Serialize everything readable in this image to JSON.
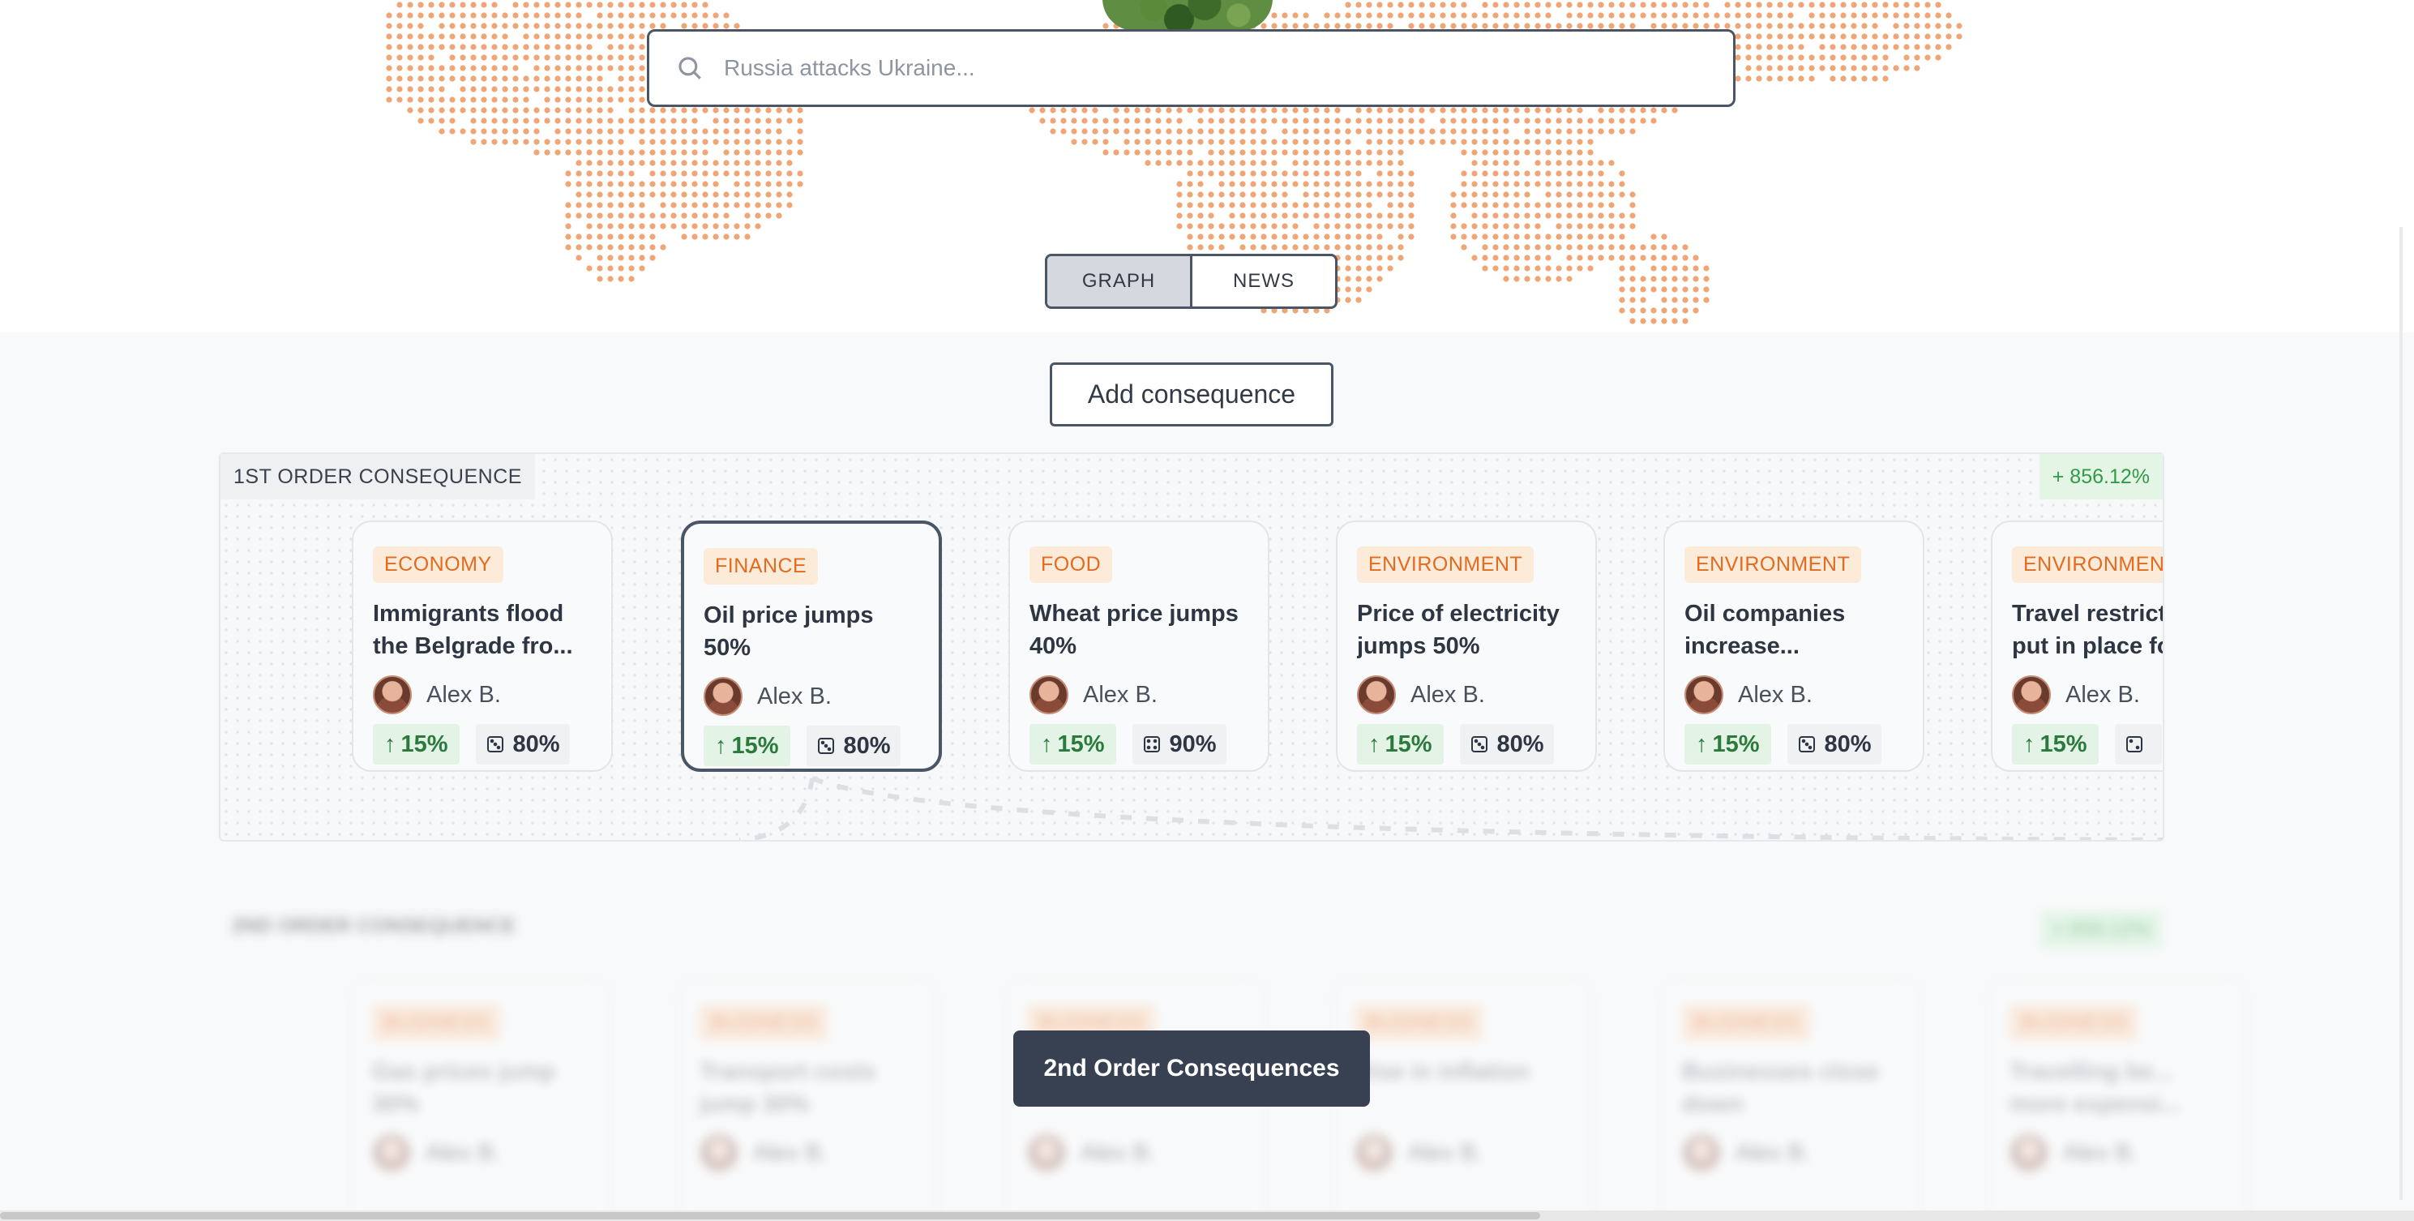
{
  "search": {
    "placeholder": "Russia attacks Ukraine..."
  },
  "view_toggle": {
    "options": [
      "GRAPH",
      "NEWS"
    ],
    "selected": "GRAPH"
  },
  "add_button_label": "Add consequence",
  "first_order": {
    "label": "1ST ORDER CONSEQUENCE",
    "badge": "+ 856.12%",
    "cards": [
      {
        "tag": "ECONOMY",
        "title": "Immigrants flood\nthe Belgrade fro...",
        "author": "Alex B.",
        "change": "15%",
        "probability": "80%"
      },
      {
        "tag": "FINANCE",
        "title": "Oil price jumps\n50%",
        "author": "Alex B.",
        "change": "15%",
        "probability": "80%"
      },
      {
        "tag": "FOOD",
        "title": "Wheat price jumps\n40%",
        "author": "Alex B.",
        "change": "15%",
        "probability": "90%"
      },
      {
        "tag": "ENVIRONMENT",
        "title": "Price of electricity\njumps 50%",
        "author": "Alex B.",
        "change": "15%",
        "probability": "80%"
      },
      {
        "tag": "ENVIRONMENT",
        "title": "Oil companies\nincrease...",
        "author": "Alex B.",
        "change": "15%",
        "probability": "80%"
      },
      {
        "tag": "ENVIRONMENT",
        "title": "Travel restrictions\nput in place for",
        "author": "Alex B.",
        "change": "15%",
        "probability": ""
      }
    ]
  },
  "second_order": {
    "label": "2ND ORDER CONSEQUENCE",
    "badge": "+ 856.12%",
    "cards": [
      {
        "tag": "BUSINESS",
        "title": "Gas prices jump\n30%",
        "author": "Alex B."
      },
      {
        "tag": "BUSINESS",
        "title": "Transport costs\njump 30%",
        "author": "Alex B."
      },
      {
        "tag": "BUSINESS",
        "title": "",
        "author": "Alex B."
      },
      {
        "tag": "BUSINESS",
        "title": "Rise in inflation",
        "author": "Alex B."
      },
      {
        "tag": "BUSINESS",
        "title": "Businesses close\ndown",
        "author": "Alex B."
      },
      {
        "tag": "BUSINESS",
        "title": "Travelling be...\nmore expensi...",
        "author": "Alex B."
      }
    ]
  },
  "cta_label": "2nd Order Consequences",
  "colors": {
    "accent_orange": "#e36b1f",
    "map_dots": "#f0a574",
    "dark_button": "#374151",
    "positive_green": "#2f9b46"
  },
  "icons": {
    "search": "search-icon",
    "up": "arrow-up-icon",
    "probability": "dice-icon"
  }
}
